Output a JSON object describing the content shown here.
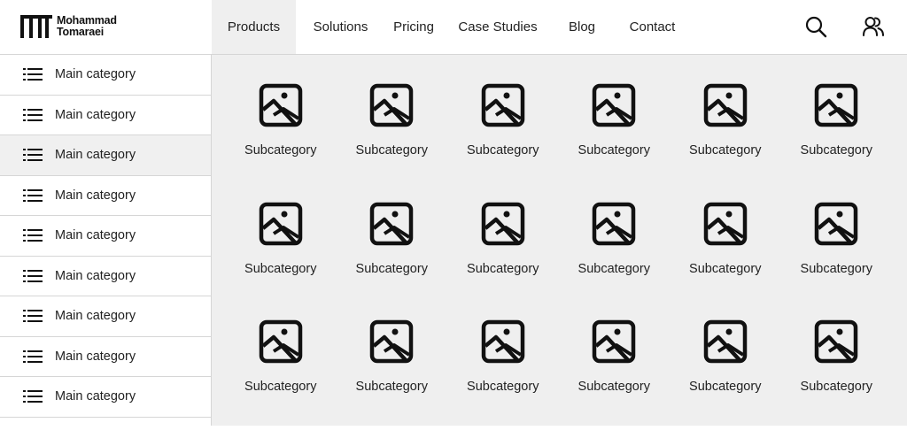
{
  "logo": {
    "line1": "Mohammad",
    "line2": "Tomaraei",
    "icon": "mt-logo"
  },
  "nav": {
    "items": [
      {
        "label": "Products",
        "active": true
      },
      {
        "label": "Solutions"
      },
      {
        "label": "Pricing"
      },
      {
        "label": "Case Studies"
      },
      {
        "label": "Blog"
      },
      {
        "label": "Contact"
      }
    ]
  },
  "header_actions": {
    "search_icon": "search-icon",
    "account_icon": "users-icon"
  },
  "sidebar": {
    "items": [
      {
        "label": "Main category",
        "icon": "list-icon"
      },
      {
        "label": "Main category",
        "icon": "list-icon"
      },
      {
        "label": "Main category",
        "icon": "list-icon",
        "active": true
      },
      {
        "label": "Main category",
        "icon": "list-icon"
      },
      {
        "label": "Main category",
        "icon": "list-icon"
      },
      {
        "label": "Main category",
        "icon": "list-icon"
      },
      {
        "label": "Main category",
        "icon": "list-icon"
      },
      {
        "label": "Main category",
        "icon": "list-icon"
      },
      {
        "label": "Main category",
        "icon": "list-icon"
      }
    ]
  },
  "subcategories": {
    "items": [
      {
        "label": "Subcategory",
        "icon": "image-icon"
      },
      {
        "label": "Subcategory",
        "icon": "image-icon"
      },
      {
        "label": "Subcategory",
        "icon": "image-icon"
      },
      {
        "label": "Subcategory",
        "icon": "image-icon"
      },
      {
        "label": "Subcategory",
        "icon": "image-icon"
      },
      {
        "label": "Subcategory",
        "icon": "image-icon"
      },
      {
        "label": "Subcategory",
        "icon": "image-icon"
      },
      {
        "label": "Subcategory",
        "icon": "image-icon"
      },
      {
        "label": "Subcategory",
        "icon": "image-icon"
      },
      {
        "label": "Subcategory",
        "icon": "image-icon"
      },
      {
        "label": "Subcategory",
        "icon": "image-icon"
      },
      {
        "label": "Subcategory",
        "icon": "image-icon"
      },
      {
        "label": "Subcategory",
        "icon": "image-icon"
      },
      {
        "label": "Subcategory",
        "icon": "image-icon"
      },
      {
        "label": "Subcategory",
        "icon": "image-icon"
      },
      {
        "label": "Subcategory",
        "icon": "image-icon"
      },
      {
        "label": "Subcategory",
        "icon": "image-icon"
      },
      {
        "label": "Subcategory",
        "icon": "image-icon"
      }
    ]
  },
  "colors": {
    "active_background": "#efefef",
    "content_background": "#efefef",
    "border": "#d6d6d6",
    "text": "#222222"
  }
}
